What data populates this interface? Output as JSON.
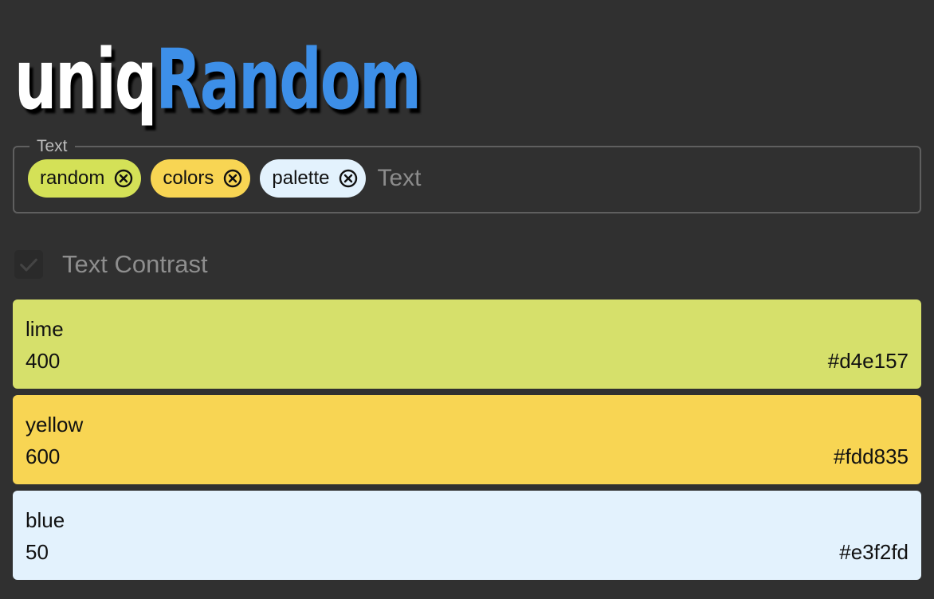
{
  "logo": {
    "part1": "uniq",
    "part2": "Random"
  },
  "text_field": {
    "legend": "Text",
    "placeholder": "Text",
    "chips": [
      {
        "label": "random",
        "color": "#d4e157",
        "icon": "close-circle-icon"
      },
      {
        "label": "colors",
        "color": "#fdd835",
        "icon": "close-circle-icon"
      },
      {
        "label": "palette",
        "color": "#e3f2fd",
        "icon": "close-circle-icon"
      }
    ]
  },
  "contrast": {
    "label": "Text Contrast",
    "checked": true
  },
  "colors": [
    {
      "name": "lime",
      "shade": "400",
      "hex": "#d4e157"
    },
    {
      "name": "yellow",
      "shade": "600",
      "hex": "#fdd835"
    },
    {
      "name": "blue",
      "shade": "50",
      "hex": "#e3f2fd"
    }
  ]
}
